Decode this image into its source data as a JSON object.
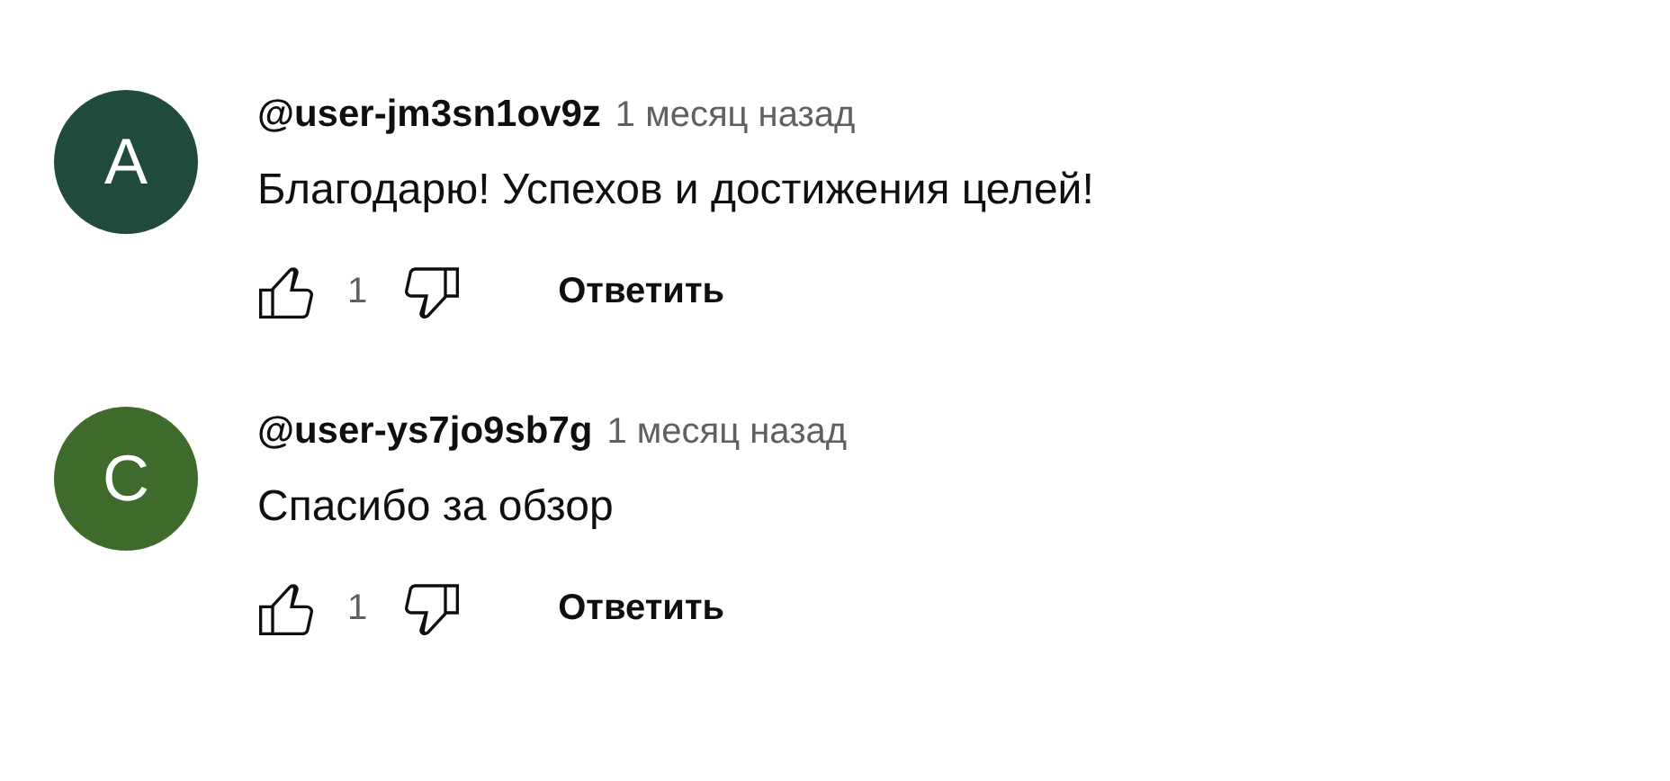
{
  "comments": [
    {
      "avatar": {
        "letter": "A",
        "color": "#1f4a3c"
      },
      "author": "@user-jm3sn1ov9z",
      "time": "1 месяц назад",
      "text": "Благодарю! Успехов и достижения целей!",
      "likes": "1",
      "reply": "Ответить"
    },
    {
      "avatar": {
        "letter": "C",
        "color": "#3e6b2b"
      },
      "author": "@user-ys7jo9sb7g",
      "time": "1 месяц назад",
      "text": "Спасибо за обзор",
      "likes": "1",
      "reply": "Ответить"
    }
  ]
}
